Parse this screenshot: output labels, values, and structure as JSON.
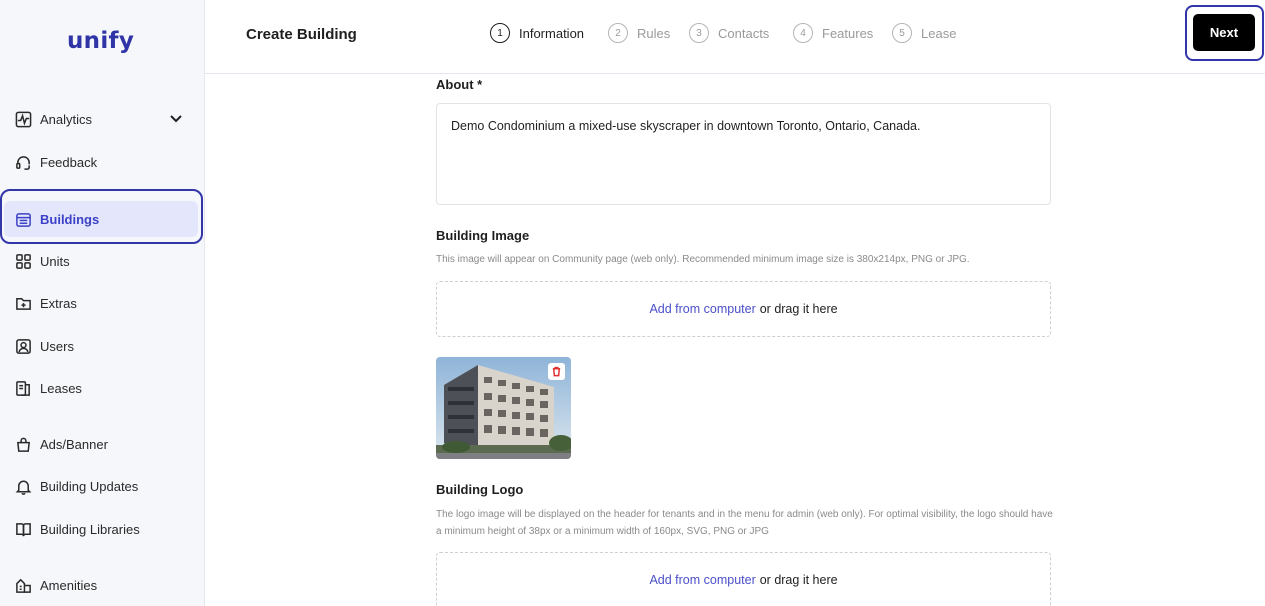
{
  "app": {
    "logo": "unify"
  },
  "sidebar": {
    "items": [
      {
        "label": "Analytics",
        "icon": "activity-icon"
      },
      {
        "label": "Feedback",
        "icon": "headset-icon"
      },
      {
        "label": "Buildings",
        "icon": "building-icon",
        "active": true
      },
      {
        "label": "Units",
        "icon": "grid-icon"
      },
      {
        "label": "Extras",
        "icon": "folder-plus-icon"
      },
      {
        "label": "Users",
        "icon": "user-square-icon"
      },
      {
        "label": "Leases",
        "icon": "document-stack-icon"
      },
      {
        "label": "Ads/Banner",
        "icon": "bag-icon"
      },
      {
        "label": "Building Updates",
        "icon": "bell-icon"
      },
      {
        "label": "Building Libraries",
        "icon": "book-open-icon"
      },
      {
        "label": "Amenities",
        "icon": "amenities-icon"
      }
    ]
  },
  "header": {
    "title": "Create Building",
    "steps": [
      {
        "num": "1",
        "label": "Information",
        "current": true
      },
      {
        "num": "2",
        "label": "Rules"
      },
      {
        "num": "3",
        "label": "Contacts"
      },
      {
        "num": "4",
        "label": "Features"
      },
      {
        "num": "5",
        "label": "Lease"
      }
    ],
    "next_label": "Next"
  },
  "form": {
    "about_label": "About *",
    "about_value": "Demo Condominium a mixed-use skyscraper in downtown Toronto, Ontario, Canada.",
    "image_label": "Building Image",
    "image_hint": "This image will appear on Community page (web only). Recommended minimum image size is 380x214px, PNG or JPG.",
    "image_drop_link": "Add from computer",
    "image_drop_text": "or drag it here",
    "logo_label": "Building Logo",
    "logo_hint": "The logo image will be displayed on the header for tenants and in the menu for admin (web only). For optimal visibility, the logo should have a minimum height of 38px or a minimum width of 160px, SVG, PNG or JPG",
    "logo_drop_link": "Add from computer",
    "logo_drop_text": "or drag it here"
  },
  "colors": {
    "accent": "#3c41c7",
    "highlight_ring": "#3336a8",
    "primary_button": "#000000"
  }
}
